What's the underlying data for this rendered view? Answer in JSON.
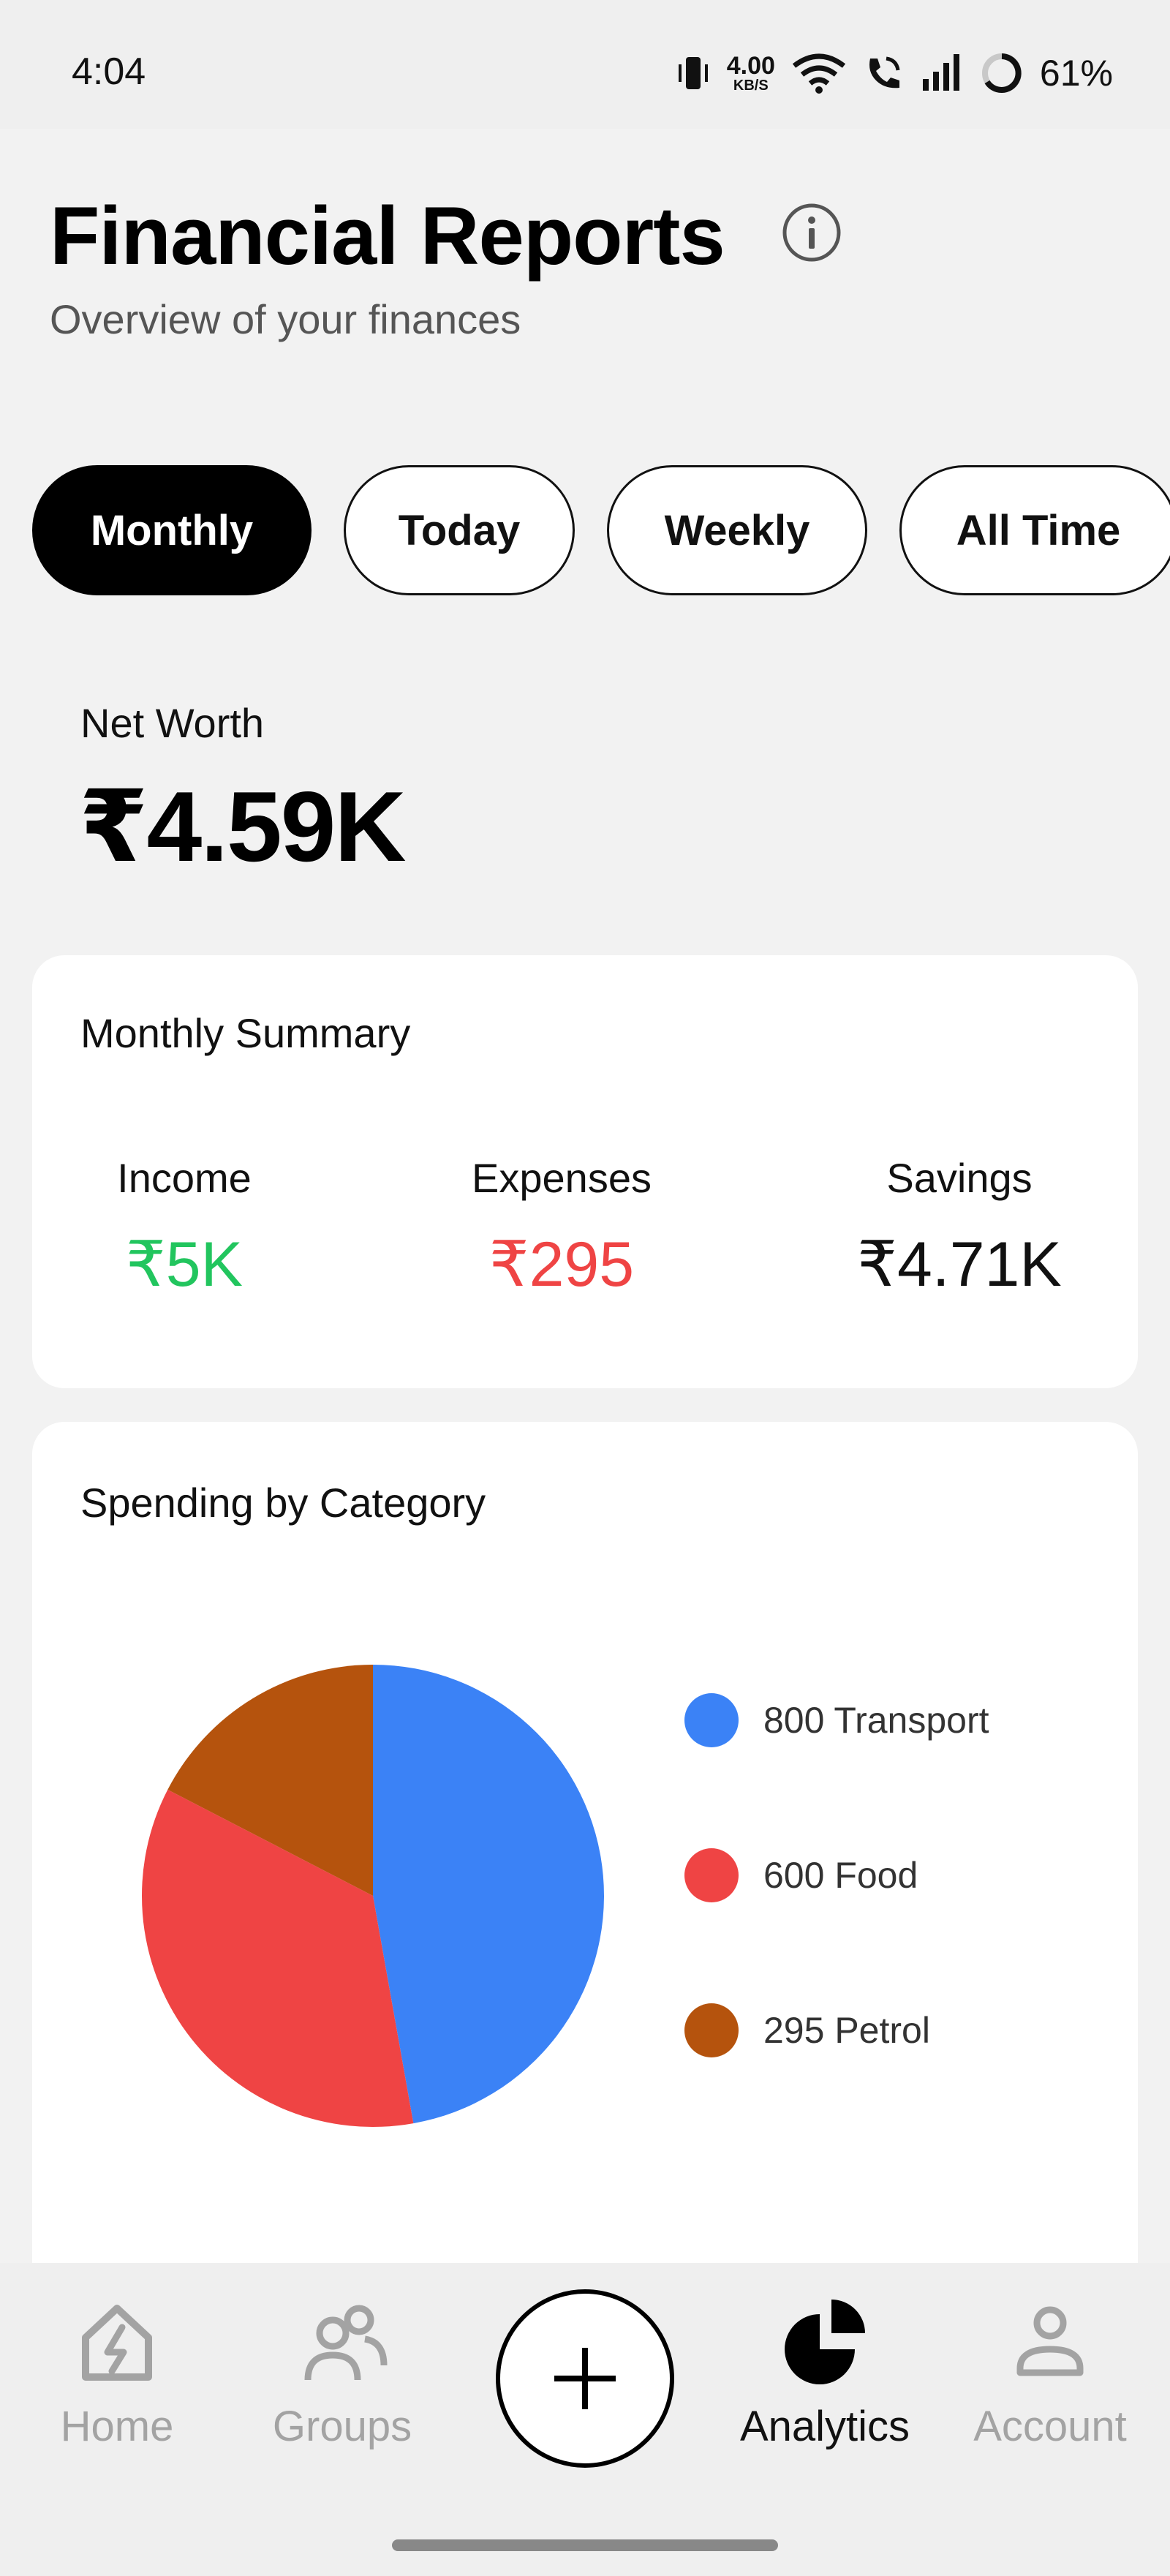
{
  "status_bar": {
    "time": "4:04",
    "net_speed_value": "4.00",
    "net_speed_unit": "KB/S",
    "battery": "61%",
    "icons": [
      "vibrate-icon",
      "wifi-icon",
      "wifi-calling-icon",
      "signal-icon",
      "battery-icon"
    ]
  },
  "header": {
    "title": "Financial Reports",
    "subtitle": "Overview of your finances"
  },
  "tabs": [
    {
      "label": "Monthly",
      "active": true
    },
    {
      "label": "Today",
      "active": false
    },
    {
      "label": "Weekly",
      "active": false
    },
    {
      "label": "All Time",
      "active": false
    }
  ],
  "net_worth": {
    "label": "Net Worth",
    "value": "₹4.59K"
  },
  "summary": {
    "title": "Monthly Summary",
    "income_label": "Income",
    "income_value": "₹5K",
    "expenses_label": "Expenses",
    "expenses_value": "₹295",
    "savings_label": "Savings",
    "savings_value": "₹4.71K"
  },
  "spending": {
    "title": "Spending by Category",
    "legend": [
      {
        "label": "800 Transport",
        "color": "#3b82f6"
      },
      {
        "label": "600 Food",
        "color": "#ef4444"
      },
      {
        "label": "295 Petrol",
        "color": "#b5530d"
      }
    ]
  },
  "chart_data": {
    "type": "pie",
    "categories": [
      "Transport",
      "Food",
      "Petrol"
    ],
    "values": [
      800,
      600,
      295
    ],
    "colors": [
      "#3b82f6",
      "#ef4444",
      "#b5530d"
    ]
  },
  "bottom_nav": {
    "home": "Home",
    "groups": "Groups",
    "analytics": "Analytics",
    "account": "Account",
    "active": "Analytics"
  },
  "colors": {
    "income": "#22c55e",
    "expenses": "#ef4444",
    "accent": "#000000"
  }
}
